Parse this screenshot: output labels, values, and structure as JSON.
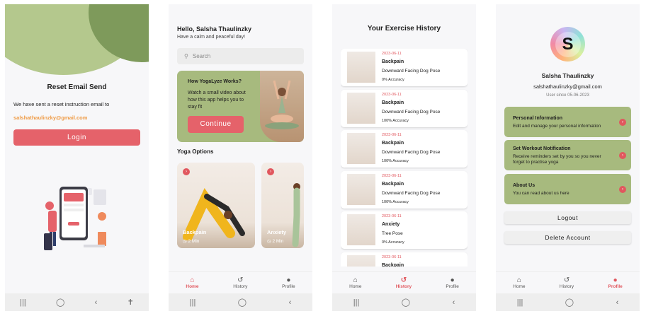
{
  "reset": {
    "title": "Reset Email Send",
    "text": "We have sent a reset instruction email to",
    "email": "salshathaulinzky@gmail.com",
    "login_label": "Login"
  },
  "home": {
    "greeting": "Hello, Salsha Thaulinzky",
    "subtitle": "Have a calm and peaceful day!",
    "search_placeholder": "Search",
    "promo": {
      "title": "How YogaLyze Works?",
      "text": "Watch a small video about how this app helps you to stay fit",
      "button": "Continue"
    },
    "section_title": "Yoga Options",
    "cards": [
      {
        "name": "Backpain",
        "duration": "2 Min"
      },
      {
        "name": "Anxiety",
        "duration": "2 Min"
      }
    ]
  },
  "history": {
    "title": "Your Exercise History",
    "items": [
      {
        "date": "2023-06-11",
        "category": "Backpain",
        "pose": "Downward Facing Dog Pose",
        "accuracy": "0% Accuracy"
      },
      {
        "date": "2023-06-11",
        "category": "Backpain",
        "pose": "Downward Facing Dog Pose",
        "accuracy": "100% Accuracy"
      },
      {
        "date": "2023-06-11",
        "category": "Backpain",
        "pose": "Downward Facing Dog Pose",
        "accuracy": "100% Accuracy"
      },
      {
        "date": "2023-06-11",
        "category": "Backpain",
        "pose": "Downward Facing Dog Pose",
        "accuracy": "100% Accuracy"
      },
      {
        "date": "2023-06-11",
        "category": "Anxiety",
        "pose": "Tree Pose",
        "accuracy": "0% Accuracy"
      },
      {
        "date": "2023-06-11",
        "category": "Backpain",
        "pose": "",
        "accuracy": ""
      }
    ]
  },
  "profile": {
    "initial": "S",
    "name": "Salsha Thaulinzky",
    "email": "salshathaulinzky@gmail.com",
    "since": "User since 05-06-2023",
    "options": [
      {
        "title": "Personal Information",
        "desc": "Edit and manage your personal information"
      },
      {
        "title": "Set Workout Notification",
        "desc": "Receive reminders set by you so you never forget to practise yoga"
      },
      {
        "title": "About Us",
        "desc": "You can read about us here"
      }
    ],
    "logout": "Logout",
    "delete": "Delete Account"
  },
  "nav": {
    "home": "Home",
    "history": "History",
    "profile": "Profile"
  },
  "colors": {
    "accent": "#e5626a",
    "green": "#a7ba7e",
    "orange": "#ef9b45"
  }
}
